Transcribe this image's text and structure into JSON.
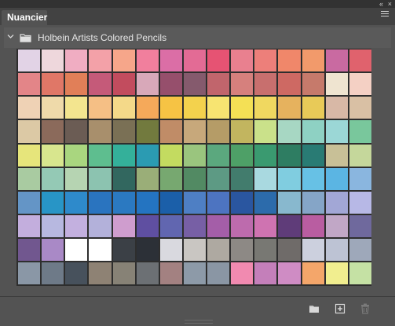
{
  "panel": {
    "tab_title": "Nuancier",
    "collapse_glyph": "«",
    "close_glyph": "×"
  },
  "group": {
    "title": "Holbein Artists Colored Pencils",
    "expanded": true,
    "icon": "folder-icon"
  },
  "swatches": [
    [
      "#e2d3e6",
      "#eed7dc",
      "#f0adc2",
      "#f3a1a8",
      "#f6a68a",
      "#f17f9d",
      "#db6ea6",
      "#e36b95",
      "#e65373",
      "#e9808f",
      "#ed7f7a",
      "#f0876a",
      "#f29a6b",
      "#c96aa1",
      "#e0626d"
    ],
    [
      "#e38588",
      "#e07767",
      "#e17f58",
      "#c55a79",
      "#c24c5e",
      "#d8a8b9",
      "#964f6c",
      "#855a6d",
      "#c1656c",
      "#d6807d",
      "#c86f6e",
      "#ce6963",
      "#c67a6b",
      "#efe4d0",
      "#f4d0c4"
    ],
    [
      "#efd2b5",
      "#efdaaa",
      "#f3e58f",
      "#f5bf85",
      "#f4d989",
      "#f5a95a",
      "#f6c344",
      "#f3d24d",
      "#f7e471",
      "#f4e055",
      "#f0d860",
      "#e6b25e",
      "#e8ca58",
      "#d8b8a6",
      "#d9c0a4"
    ],
    [
      "#dcc9a5",
      "#8b6a5b",
      "#6b5c54",
      "#a88f6c",
      "#7a7055",
      "#727a3e",
      "#c08c67",
      "#c7a87b",
      "#b59c67",
      "#c2b55f",
      "#cae18a",
      "#a7d7c3",
      "#8ed1c3",
      "#9bd7d6",
      "#79c79c"
    ],
    [
      "#e6e57b",
      "#d8e68e",
      "#a9d67f",
      "#5ebe8f",
      "#34b09a",
      "#2b9bb2",
      "#c3db60",
      "#9ac57e",
      "#5ba87e",
      "#4ea067",
      "#3a9a70",
      "#2e7d62",
      "#297b74",
      "#c8c097",
      "#c5d79b"
    ],
    [
      "#a9cba1",
      "#94c9b5",
      "#b6d4b2",
      "#8cc3b0",
      "#32675f",
      "#9aae78",
      "#77a870",
      "#528a63",
      "#5d9a84",
      "#427c6d",
      "#a9d9e0",
      "#80cde0",
      "#67c1e5",
      "#5bb5e3",
      "#8ab6df"
    ],
    [
      "#6495c6",
      "#2895c6",
      "#2e8acb",
      "#2a74bf",
      "#2b79c1",
      "#2474c1",
      "#1b5fa9",
      "#4e7fc4",
      "#4d74c1",
      "#2a56a0",
      "#2c6bab",
      "#88b8ce",
      "#85a5c7",
      "#a2a7d6",
      "#b7b8e6"
    ],
    [
      "#c3aedd",
      "#b7b8e0",
      "#c3b0df",
      "#b3b1da",
      "#cf9dce",
      "#5f4fa1",
      "#6166b0",
      "#775fa5",
      "#a45ea8",
      "#bd6bad",
      "#cf73b1",
      "#5f3c79",
      "#b95da1",
      "#c1a7c6",
      "#6f699d"
    ],
    [
      "#71578f",
      "#a989c6",
      "#ffffff",
      "#ffffff",
      "#3b4046",
      "#2c3037",
      "#d9d9df",
      "#c9c6c2",
      "#aea9a1",
      "#8d8985",
      "#787873",
      "#6f6b69",
      "#ccd0de",
      "#bdc3d4",
      "#9ea8ba"
    ],
    [
      "#8a97a6",
      "#6e7a88",
      "#47515c",
      "#8e8274",
      "#878276",
      "#6c7074",
      "#a38181",
      "#8d9aa8",
      "#8a96a4",
      "#f18ab0",
      "#c47fba",
      "#cf8cc4",
      "#f4a66a",
      "#f1ee8f",
      "#c5e1a4"
    ]
  ]
}
